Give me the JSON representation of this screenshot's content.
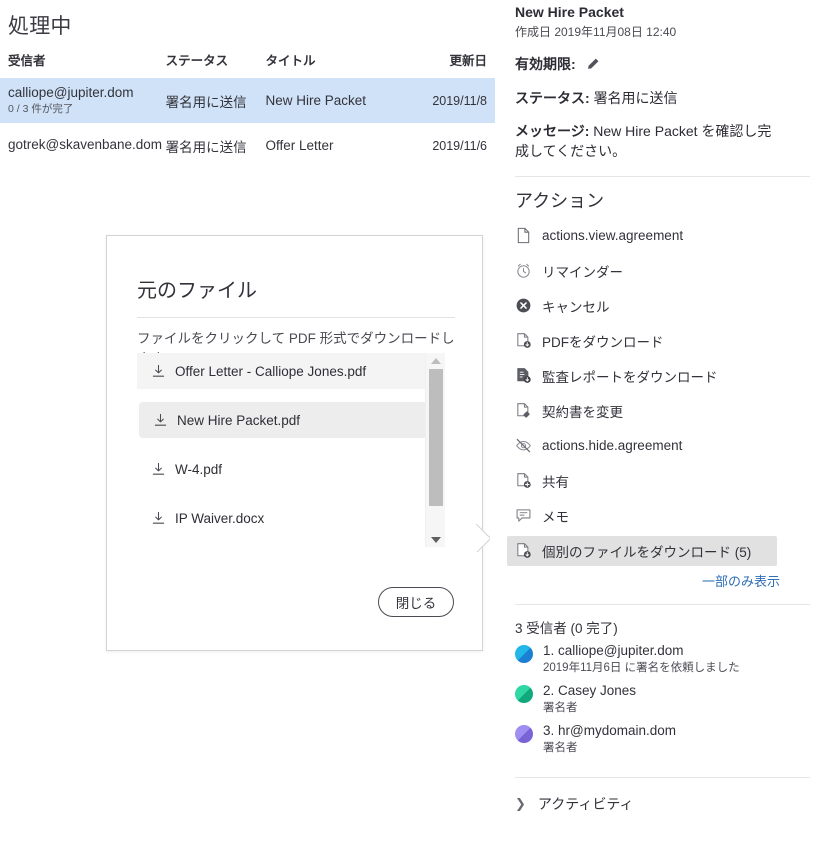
{
  "left": {
    "page_title": "処理中",
    "table": {
      "columns": [
        "受信者",
        "ステータス",
        "タイトル",
        "更新日"
      ],
      "rows": [
        {
          "recipient": "calliope@jupiter.dom",
          "sub": "0 / 3 件が完了",
          "status": "署名用に送信",
          "title": "New Hire Packet",
          "updated": "2019/11/8",
          "selected": true
        },
        {
          "recipient": "gotrek@skavenbane.dom",
          "sub": "",
          "status": "署名用に送信",
          "title": "Offer Letter",
          "updated": "2019/11/6",
          "selected": false
        }
      ]
    }
  },
  "modal": {
    "title": "元のファイル",
    "subtitle": "ファイルをクリックして PDF 形式でダウンロードします。",
    "files": [
      {
        "name": "Offer Letter - Calliope Jones.pdf",
        "icon": "download-icon",
        "state": "shaded"
      },
      {
        "name": "New Hire Packet.pdf",
        "icon": "download-icon",
        "state": "hovered"
      },
      {
        "name": "W-4.pdf",
        "icon": "download-icon",
        "state": "normal"
      },
      {
        "name": "IP Waiver.docx",
        "icon": "download-icon",
        "state": "normal"
      }
    ],
    "close_label": "閉じる",
    "scrollbar": {
      "up_icon": "caret-up-icon",
      "down_icon": "caret-down-icon"
    }
  },
  "right": {
    "doc_name": "New Hire Packet",
    "created": "作成日 2019年11月08日 12:40",
    "expiry_label": "有効期限:",
    "expiry_icon": "pencil-icon",
    "status_label": "ステータス:",
    "status_value": "署名用に送信",
    "message_label": "メッセージ:",
    "message_value": "New Hire Packet を確認し完成してください。",
    "actions_title": "アクション",
    "actions": [
      {
        "label": "actions.view.agreement",
        "icon": "document-icon",
        "active": false
      },
      {
        "label": "リマインダー",
        "icon": "alarm-clock-icon",
        "active": false
      },
      {
        "label": "キャンセル",
        "icon": "cancel-circle-icon",
        "active": false
      },
      {
        "label": "PDFをダウンロード",
        "icon": "pdf-download-icon",
        "active": false
      },
      {
        "label": "監査レポートをダウンロード",
        "icon": "audit-report-download-icon",
        "active": false
      },
      {
        "label": "契約書を変更",
        "icon": "document-edit-icon",
        "active": false
      },
      {
        "label": "actions.hide.agreement",
        "icon": "eye-hidden-icon",
        "active": false
      },
      {
        "label": "共有",
        "icon": "share-document-icon",
        "active": false
      },
      {
        "label": "メモ",
        "icon": "note-icon",
        "active": false
      },
      {
        "label": "個別のファイルをダウンロード (5)",
        "icon": "file-download-icon",
        "active": true
      }
    ],
    "partial_link": "一部のみ表示",
    "recipients_count": "3 受信者 (0 完了)",
    "recipients": [
      {
        "name": "1. calliope@jupiter.dom",
        "sub": "2019年11月6日 に署名を依頼しました",
        "avatar_color_a": "#23b6e8",
        "avatar_color_b": "#1b7fd4"
      },
      {
        "name": "2. Casey Jones",
        "sub": "署名者",
        "avatar_color_a": "#2fd7a4",
        "avatar_color_b": "#11a87e"
      },
      {
        "name": "3. hr@mydomain.dom",
        "sub": "署名者",
        "avatar_color_a": "#a08ff0",
        "avatar_color_b": "#7a63d6"
      }
    ],
    "activity_label": "アクティビティ",
    "activity_icon": "chevron-right-icon"
  },
  "colors": {
    "selected_row": "#cfe2f7",
    "link": "#2f6fb5",
    "active_action": "#e1e1e1"
  }
}
